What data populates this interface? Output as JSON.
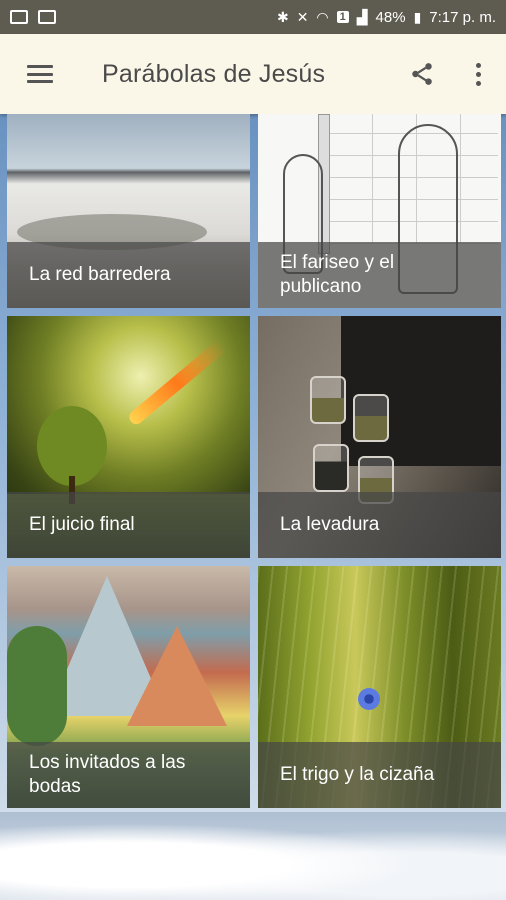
{
  "status_bar": {
    "battery": "48%",
    "time": "7:17 p. m.",
    "sim_badge": "1"
  },
  "app_bar": {
    "title": "Parábolas de Jesús",
    "icons": [
      "menu-icon",
      "share-icon",
      "more-vert-icon"
    ]
  },
  "parables": [
    {
      "title": "La red barredera"
    },
    {
      "title": "El fariseo y el publicano"
    },
    {
      "title": "El juicio final"
    },
    {
      "title": "La levadura"
    },
    {
      "title": "Los invitados a las bodas"
    },
    {
      "title": "El trigo y la cizaña"
    }
  ]
}
